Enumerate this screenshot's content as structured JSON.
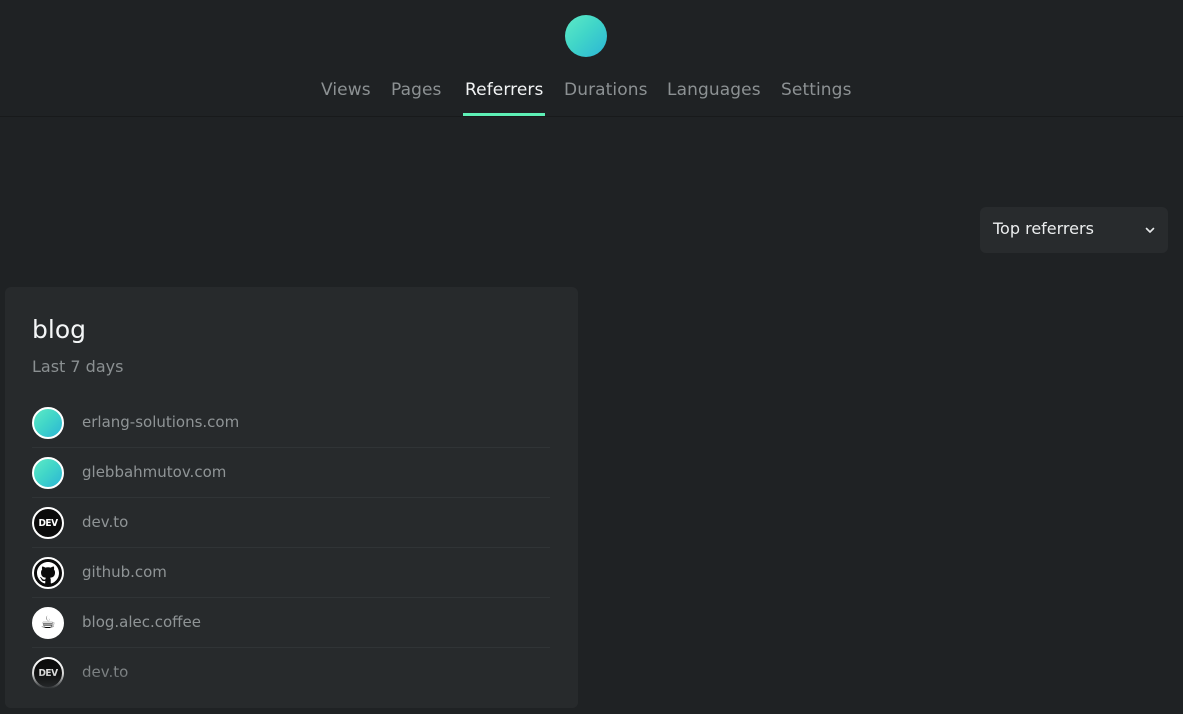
{
  "header": {
    "logo_icon": "gradient-circle-logo",
    "tabs": [
      {
        "label": "Views",
        "active": false
      },
      {
        "label": "Pages",
        "active": false
      },
      {
        "label": "Referrers",
        "active": true
      },
      {
        "label": "Durations",
        "active": false
      },
      {
        "label": "Languages",
        "active": false
      },
      {
        "label": "Settings",
        "active": false
      }
    ]
  },
  "filter": {
    "selected": "Top referrers",
    "icon": "chevron-down-icon"
  },
  "card": {
    "title": "blog",
    "subtitle": "Last 7 days",
    "referrers": [
      {
        "domain": "erlang-solutions.com",
        "icon": "gradient-circle-icon"
      },
      {
        "domain": "glebbahmutov.com",
        "icon": "gradient-circle-icon"
      },
      {
        "domain": "dev.to",
        "icon": "dev-logo-icon",
        "icon_text": "DEV"
      },
      {
        "domain": "github.com",
        "icon": "github-icon"
      },
      {
        "domain": "blog.alec.coffee",
        "icon": "coffee-icon",
        "icon_text": "☕"
      },
      {
        "domain": "dev.to",
        "icon": "dev-logo-icon",
        "icon_text": "DEV"
      }
    ]
  },
  "colors": {
    "background": "#1f2224",
    "card": "#272a2c",
    "accent": "#5ef0b6",
    "gradient_start": "#5eeac6",
    "gradient_end": "#2bb5d6"
  }
}
